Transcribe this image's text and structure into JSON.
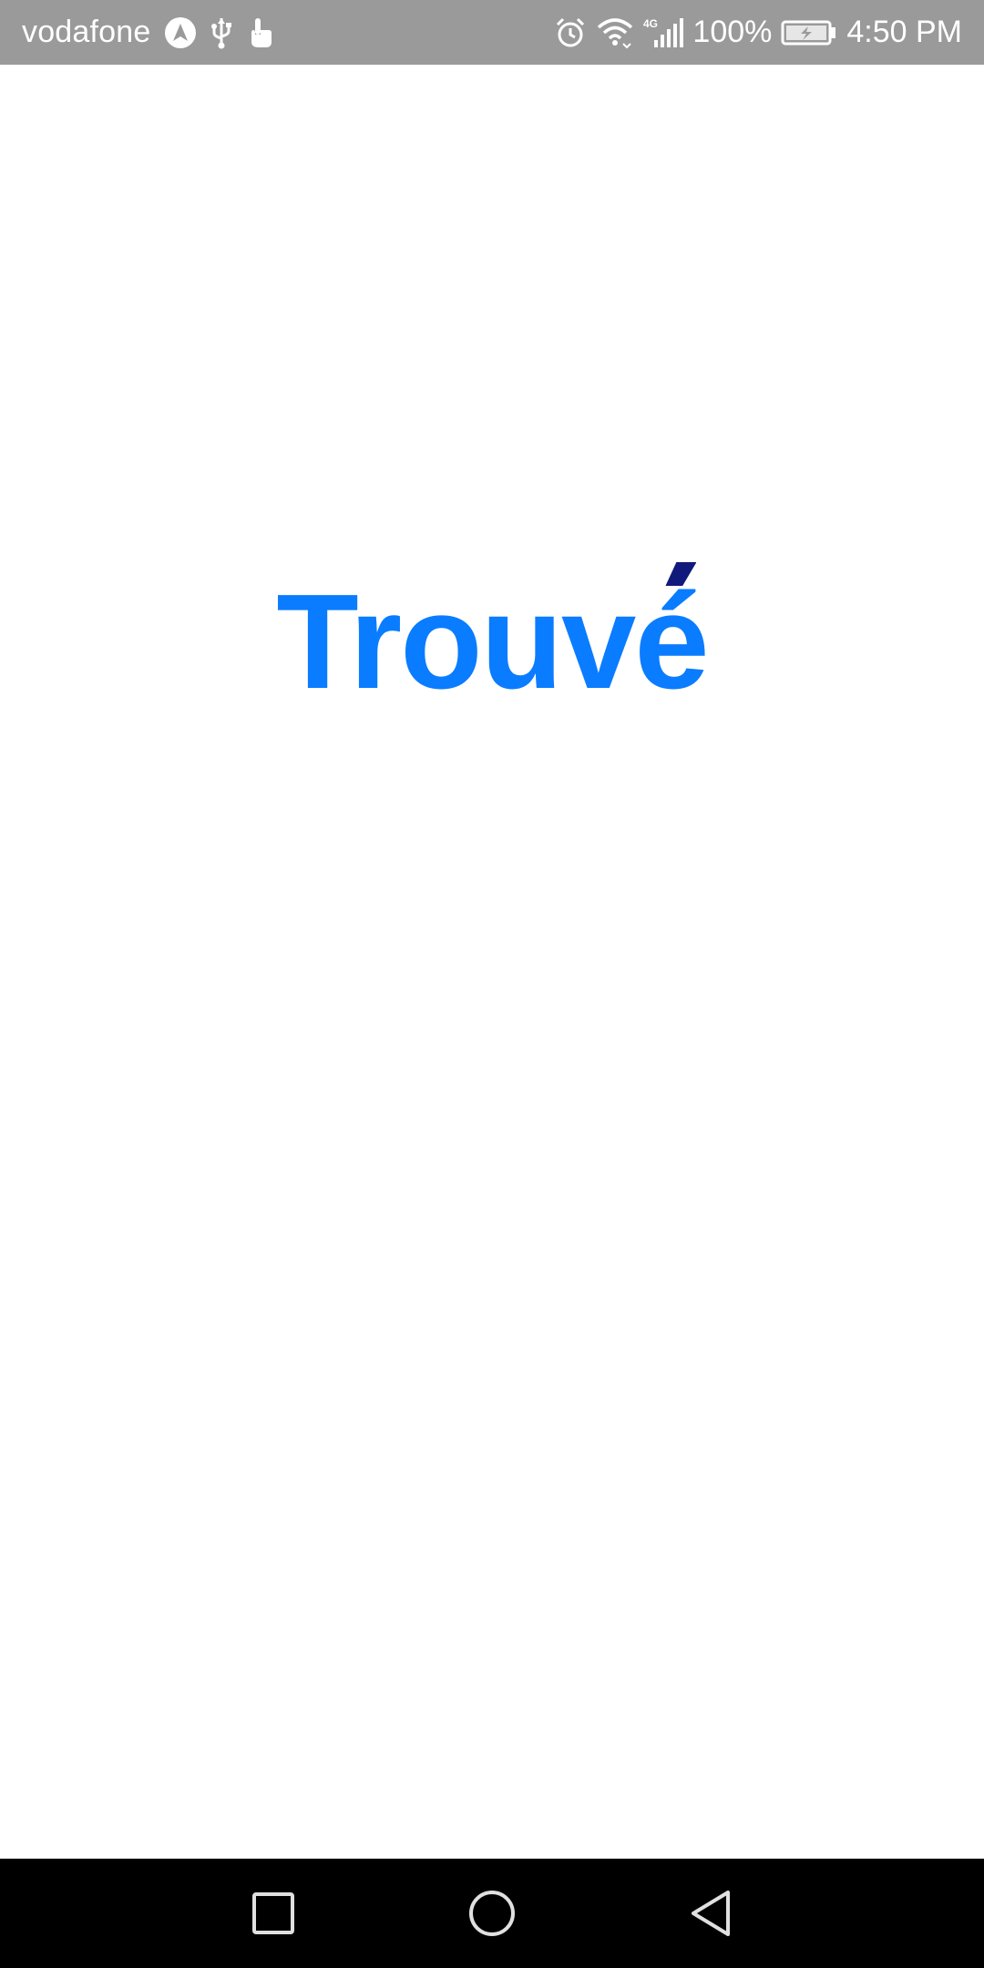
{
  "status_bar": {
    "carrier": "vodafone",
    "battery": "100%",
    "time": "4:50 PM",
    "network": "4G",
    "icons": [
      "navigation-icon",
      "usb-icon",
      "touch-icon",
      "alarm-icon",
      "wifi-icon",
      "signal-icon",
      "battery-charging-icon"
    ],
    "background_color": "#9a9a9a"
  },
  "app": {
    "logo_text_main": "Trouv",
    "logo_text_accent": "é",
    "brand_color": "#0a7cff",
    "accent_color": "#101a7a"
  },
  "nav_bar": {
    "buttons": [
      "recent-apps",
      "home",
      "back"
    ]
  }
}
